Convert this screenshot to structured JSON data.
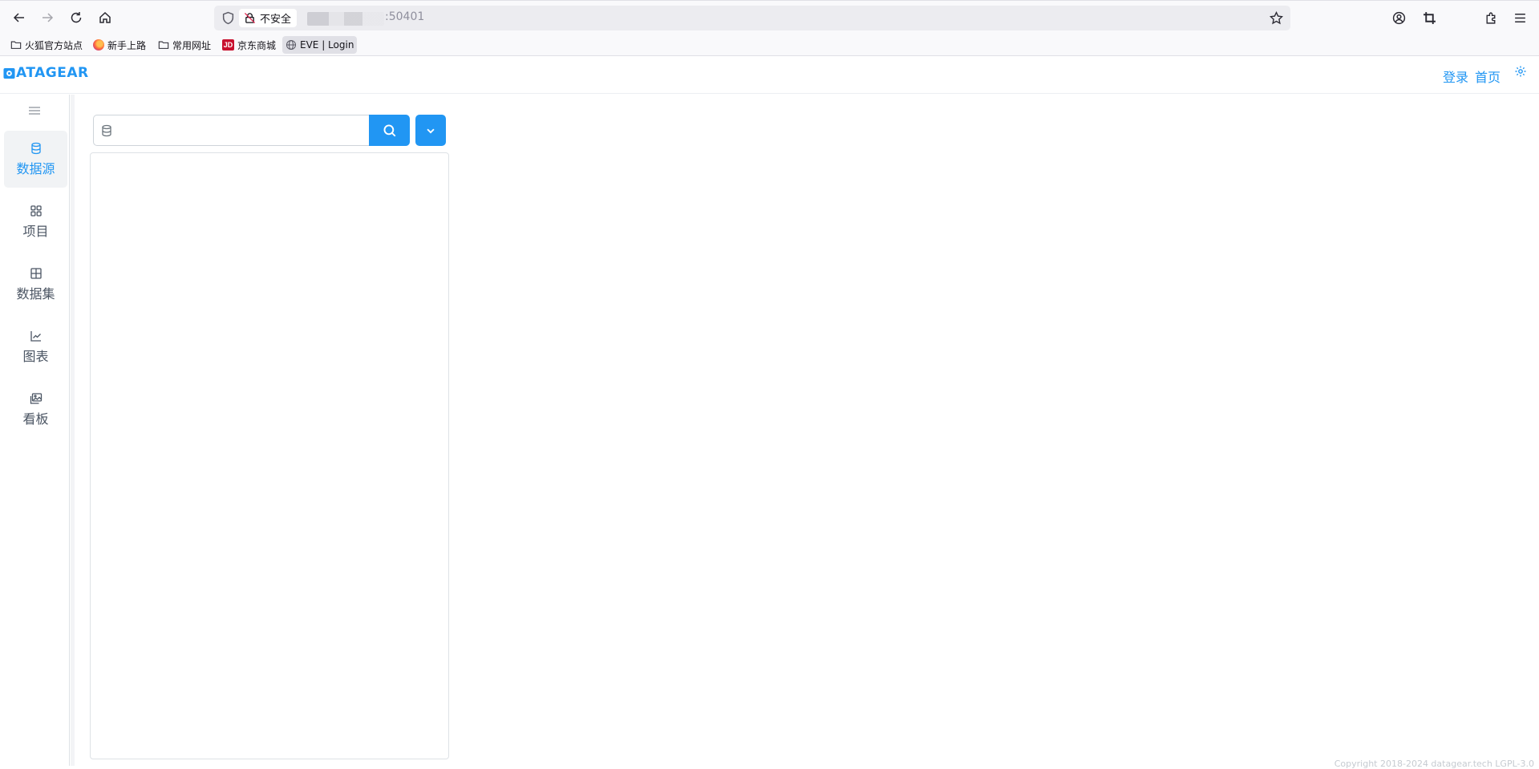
{
  "browser": {
    "url_security_label": "不安全",
    "url_text": ":50401",
    "bookmarks": [
      {
        "label": "火狐官方站点"
      },
      {
        "label": "新手上路"
      },
      {
        "label": "常用网址"
      },
      {
        "label": "京东商城",
        "badge": "JD"
      },
      {
        "label": "EVE | Login"
      }
    ]
  },
  "header": {
    "logo_text": "ATAGEAR",
    "login_label": "登录",
    "home_label": "首页"
  },
  "sidebar": {
    "items": [
      {
        "label": "数据源",
        "icon": "database-icon",
        "active": true
      },
      {
        "label": "项目",
        "icon": "grid-icon"
      },
      {
        "label": "数据集",
        "icon": "table-icon"
      },
      {
        "label": "图表",
        "icon": "chart-line-icon"
      },
      {
        "label": "看板",
        "icon": "images-icon"
      }
    ]
  },
  "main": {
    "search": {
      "value": "",
      "placeholder": ""
    },
    "footer": "Copyright 2018-2024 datagear.tech  LGPL-3.0"
  },
  "colors": {
    "accent": "#2196f3",
    "sidebar_active_bg": "#f1f3f5",
    "browser_chrome": "#f9f9fb"
  }
}
